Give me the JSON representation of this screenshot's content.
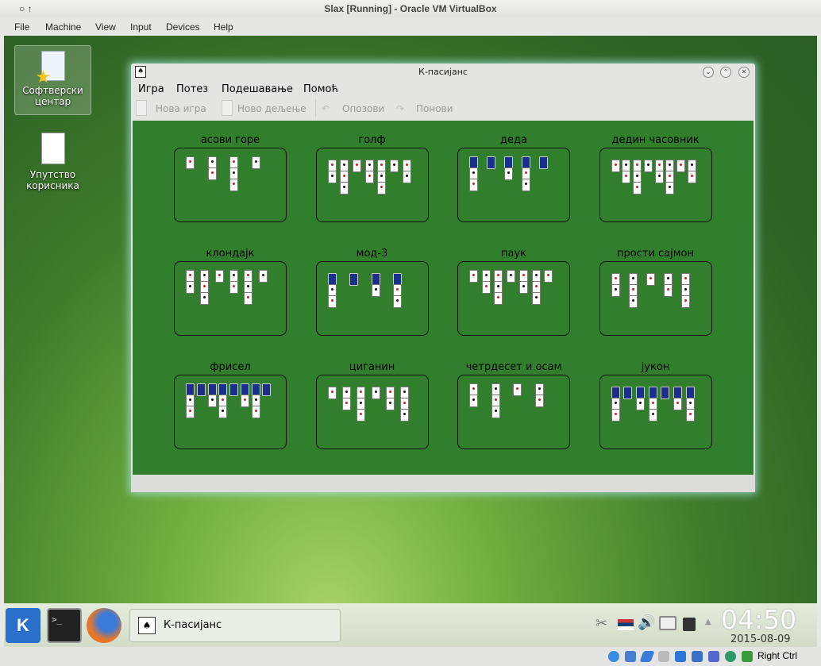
{
  "vbox": {
    "title": "Slax [Running] - Oracle VM VirtualBox",
    "menu": [
      "File",
      "Machine",
      "View",
      "Input",
      "Devices",
      "Help"
    ],
    "host_key": "Right Ctrl"
  },
  "desktop": {
    "icons": [
      {
        "label": "Софтверски центар"
      },
      {
        "label": "Упутство корисника"
      }
    ]
  },
  "app": {
    "title": "К-пасијанс",
    "menu": [
      "Игра",
      "Потез",
      "Подешавање",
      "Помоћ"
    ],
    "toolbar": [
      "Нова игра",
      "Ново дељење",
      "Опозови",
      "Понови"
    ],
    "games": [
      "асови горе",
      "голф",
      "деда",
      "дедин часовник",
      "клондајк",
      "мод-3",
      "паук",
      "прости сајмон",
      "фрисел",
      "циганин",
      "четрдесет и осам",
      "јукон"
    ]
  },
  "taskbar": {
    "task_label": "К-пасијанс",
    "clock": "04:50",
    "date": "2015-08-09"
  },
  "colors": {
    "felt": "#317e2c",
    "accent": "#2f6424"
  }
}
